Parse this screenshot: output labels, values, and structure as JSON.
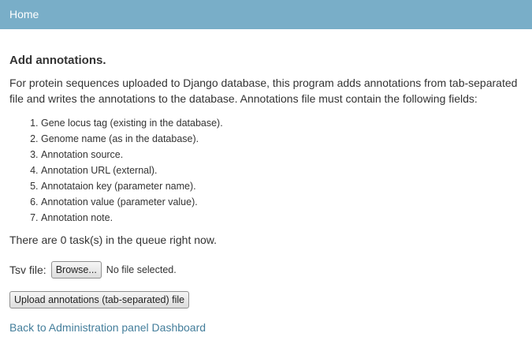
{
  "header": {
    "home_label": "Home"
  },
  "main": {
    "heading": "Add annotations.",
    "intro": "For protein sequences uploaded to Django database, this program adds annotations from tab-separated file and writes the annotations to the database. Annotations file must contain the following fields:",
    "fields": [
      "Gene locus tag (existing in the database).",
      "Genome name (as in the database).",
      "Annotation source.",
      "Annotation URL (external).",
      "Annotataion key (parameter name).",
      "Annotation value (parameter value).",
      "Annotation note."
    ],
    "queue_text": "There are 0 task(s) in the queue right now.",
    "file_label": "Tsv file:",
    "browse_label": "Browse...",
    "no_file_text": "No file selected.",
    "upload_label": "Upload annotations (tab-separated) file",
    "back_link": "Back to Administration panel Dashboard"
  },
  "colors": {
    "header_bg": "#79aec8",
    "link": "#447e9b"
  }
}
